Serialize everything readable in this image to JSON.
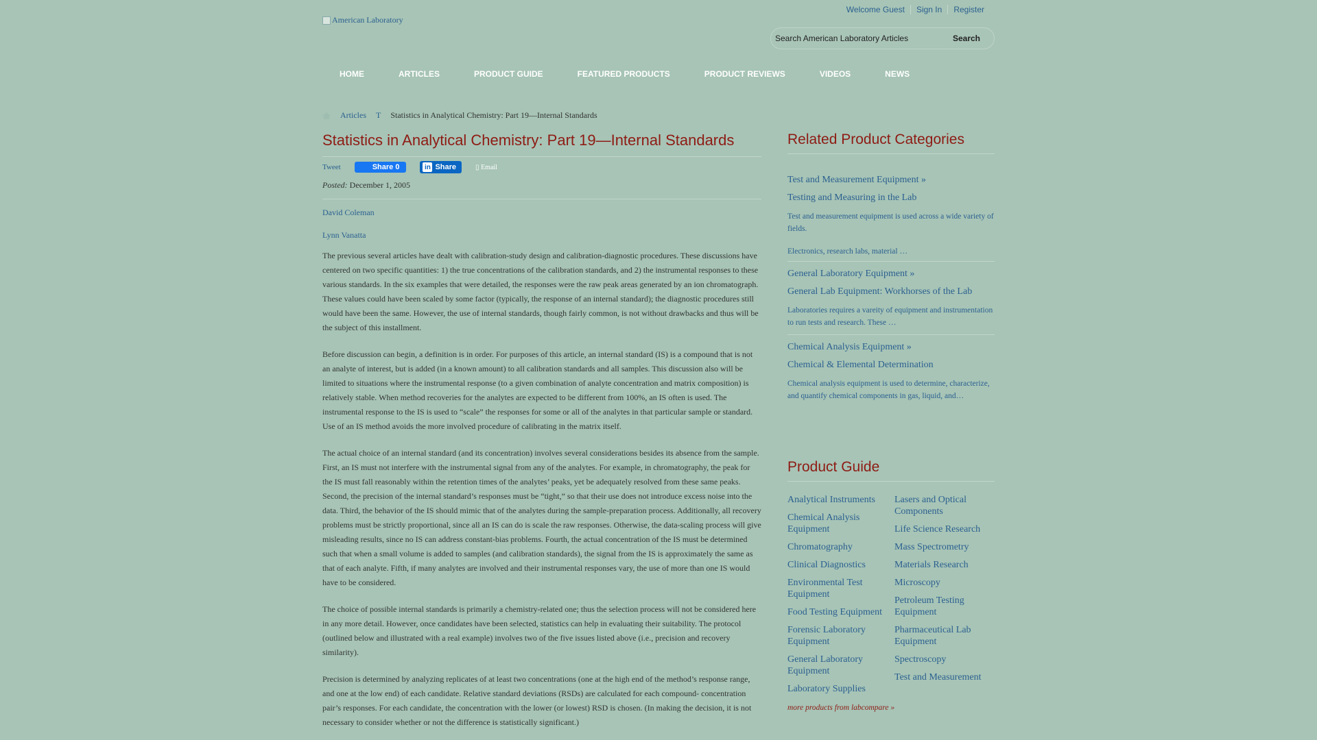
{
  "header": {
    "logo_alt": "American Laboratory",
    "welcome": "Welcome Guest",
    "sign_in": "Sign In",
    "register": "Register",
    "search_placeholder": "Search American Laboratory Articles",
    "search_button": "Search"
  },
  "nav": [
    "HOME",
    "ARTICLES",
    "PRODUCT GUIDE",
    "FEATURED PRODUCTS",
    "PRODUCT REVIEWS",
    "VIDEOS",
    "NEWS"
  ],
  "breadcrumb": {
    "articles": "Articles",
    "t": "T",
    "current": "Statistics in Analytical Chemistry: Part 19—Internal Standards"
  },
  "article": {
    "title": "Statistics in Analytical Chemistry: Part 19—Internal Standards",
    "tweet": "Tweet",
    "fb_share": "Share 0",
    "li_share": "Share",
    "email": "Email",
    "posted_label": "Posted:",
    "posted_date": "December 1, 2005",
    "authors": [
      "David Coleman",
      "Lynn Vanatta"
    ],
    "paragraphs": [
      "The previous several articles have dealt with calibration-study design and calibration-diagnostic procedures. These discussions have centered on two specific quantities: 1) the true concentrations of the calibration standards, and 2) the instrumental responses to these various standards. In the six examples that were detailed, the responses were the raw peak areas generated by an ion chromatograph. These values could have been scaled by some factor (typically, the response of an internal standard); the diagnostic procedures still would have been the same. However, the use of internal standards, though fairly common, is not without drawbacks and thus will be the subject of this installment.",
      "Before discussion can begin, a definition is in order. For purposes of this article, an internal standard (IS) is a compound that is not an analyte of interest, but is added (in a known amount) to all calibration standards and all samples. This discussion also will be limited to situations where the instrumental response (to a given combination of analyte concentration and matrix composition) is relatively stable. When method recoveries for the analytes are expected to be different from 100%, an IS often is used. The instrumental response to the IS is used to “scale” the responses for some or all of the analytes in that particular sample or standard. Use of an IS method avoids the more involved procedure of calibrating in the matrix itself.",
      "The actual choice of an internal standard (and its concentration) involves several considerations besides its absence from the sample. First, an IS must not interfere with the instrumental signal from any of the analytes. For example, in chromatography, the peak for the IS must fall reasonably within the retention times of the analytes’ peaks, yet be adequately resolved from these same peaks. Second, the precision of the internal standard’s responses must be “tight,” so that their use does not introduce excess noise into the data. Third, the behavior of the IS should mimic that of the analytes during the sample-preparation process. Additionally, all recovery problems must be strictly proportional, since all an IS can do is scale the raw responses. Otherwise, the data-scaling process will give misleading results, since no IS can address constant-bias problems. Fourth, the actual concentration of the IS must be determined such that when a small volume is added to samples (and calibration standards), the signal from the IS is approximately the same as that of each analyte. Fifth, if many analytes are involved and their instrumental responses vary, the use of more than one IS would have to be considered.",
      "The choice of possible internal standards is primarily a chemistry-related one; thus the selection process will not be considered here in any more detail. However, once candidates have been selected, statistics can help in evaluating their suitability. The protocol (outlined below and illustrated with a real example) involves two of the five issues listed above (i.e., precision and recovery similarity).",
      "Precision is determined by analyzing replicates of at least two concentrations (one at the high end of the method’s response range, and one at the low end) of each candidate. Relative standard deviations (RSDs) are calculated for each compound- concentration pair’s responses. For each candidate, the concentration with the lower (or lowest) RSD is chosen. (In making the decision, it is not necessary to consider whether or not the difference is statistically significant.)"
    ]
  },
  "related": {
    "heading": "Related Product Categories",
    "blocks": [
      {
        "category": "Test and Measurement Equipment »",
        "sub": "Testing and Measuring in the Lab",
        "desc": "Test and measurement equipment is used across a wide variety of fields.",
        "more": "Electronics, research labs, material …"
      },
      {
        "category": "General Laboratory Equipment »",
        "sub": "General Lab Equipment: Workhorses of the Lab",
        "desc": "Laboratories requires a vareity of equipment and instrumentation to run tests and research. These …",
        "more": ""
      },
      {
        "category": "Chemical Analysis Equipment »",
        "sub": "Chemical & Elemental Determination",
        "desc": "Chemical analysis equipment is used to determine, characterize, and quantify chemical components in gas, liquid, and…",
        "more": ""
      }
    ]
  },
  "product_guide": {
    "heading": "Product Guide",
    "left": [
      "Analytical Instruments",
      "Chemical Analysis Equipment",
      "Chromatography",
      "Clinical Diagnostics",
      "Environmental Test Equipment",
      "Food Testing Equipment",
      "Forensic Laboratory Equipment",
      "General Laboratory Equipment",
      "Laboratory Supplies"
    ],
    "right": [
      "Lasers and Optical Components",
      "Life Science Research",
      "Mass Spectrometry",
      "Materials Research",
      "Microscopy",
      "Petroleum Testing Equipment",
      "Pharmaceutical Lab Equipment",
      "Spectroscopy",
      "Test and Measurement"
    ],
    "more": "more products from labcompare »"
  }
}
